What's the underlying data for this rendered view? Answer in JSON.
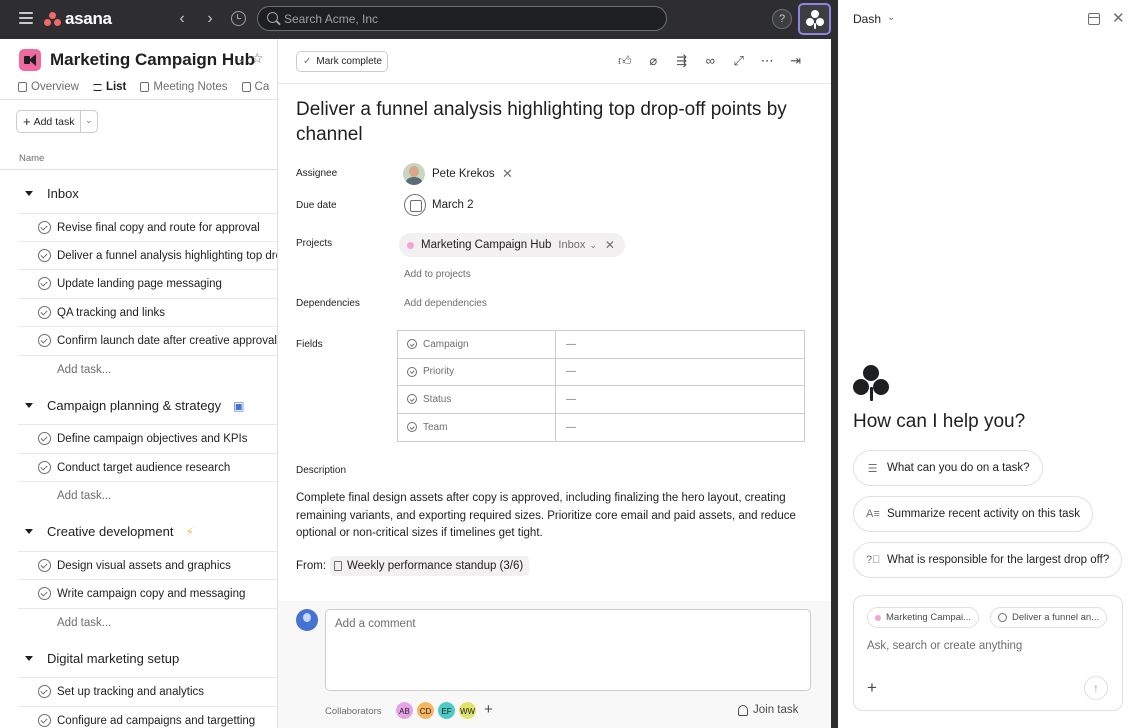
{
  "topbar": {
    "brand": "asana",
    "search_placeholder": "Search Acme, Inc",
    "help": "?",
    "back": "‹",
    "forward": "›"
  },
  "project": {
    "title": "Marketing Campaign Hub",
    "tabs": [
      {
        "label": "Overview"
      },
      {
        "label": "List"
      },
      {
        "label": "Meeting Notes"
      },
      {
        "label": "Ca"
      }
    ],
    "add_task_label": "Add task",
    "column_name": "Name",
    "add_task_row": "Add task...",
    "sections": [
      {
        "name": "Inbox",
        "tasks": [
          "Revise final copy and route for approval",
          "Deliver a funnel analysis highlighting top drop-off points by channel",
          "Update landing page messaging",
          "QA tracking and links",
          "Confirm launch date after creative approval"
        ]
      },
      {
        "name": "Campaign planning & strategy",
        "tasks": [
          "Define campaign objectives and KPIs",
          "Conduct target audience research"
        ]
      },
      {
        "name": "Creative development",
        "tasks": [
          "Design visual assets and graphics",
          "Write campaign copy and messaging"
        ]
      },
      {
        "name": "Digital marketing setup",
        "tasks": [
          "Set up tracking and analytics",
          "Configure ad campaigns and targetting"
        ]
      }
    ]
  },
  "task": {
    "mark_complete": "Mark complete",
    "title": "Deliver a funnel analysis highlighting top drop-off points by channel",
    "labels": {
      "assignee": "Assignee",
      "due_date": "Due date",
      "projects": "Projects",
      "dependencies": "Dependencies",
      "fields": "Fields",
      "description": "Description"
    },
    "assignee": "Pete Krekos",
    "due_date": "March 2",
    "project_name": "Marketing Campaign Hub",
    "project_section": "Inbox",
    "add_to_projects": "Add to projects",
    "add_dependencies": "Add dependencies",
    "fields": [
      {
        "name": "Campaign",
        "value": "—"
      },
      {
        "name": "Priority",
        "value": "—"
      },
      {
        "name": "Status",
        "value": "—"
      },
      {
        "name": "Team",
        "value": "—"
      }
    ],
    "description": "Complete final design assets after copy is approved, including finalizing the hero layout, creating remaining variants, and exporting required sizes. Prioritize core email and paid assets, and reduce optional or non-critical sizes if timelines get tight.",
    "from_label": "From:",
    "from_source": "Weekly performance standup (3/6)",
    "comment_placeholder": "Add a comment",
    "collaborators_label": "Collaborators",
    "collaborators": [
      {
        "initials": "AB",
        "color": "#e8a3e8"
      },
      {
        "initials": "CD",
        "color": "#f8b661"
      },
      {
        "initials": "EF",
        "color": "#4ecbc4"
      },
      {
        "initials": "WW",
        "color": "#e2e36b"
      }
    ],
    "join_task": "Join task"
  },
  "ai_panel": {
    "title": "Dash",
    "heading": "How can I help you?",
    "suggestions": [
      "What can you do on a task?",
      "Summarize recent activity on this task",
      "What is responsible for the largest drop off?"
    ],
    "context_chips": [
      "Marketing Campai...",
      "Deliver a funnel an..."
    ],
    "input_placeholder": "Ask, search or create anything"
  },
  "colors": {
    "topbar": "#2e2e30",
    "brand_coral": "#f06a6a",
    "project_pink": "#f06a9f",
    "ai_accent": "#8d84e8"
  }
}
